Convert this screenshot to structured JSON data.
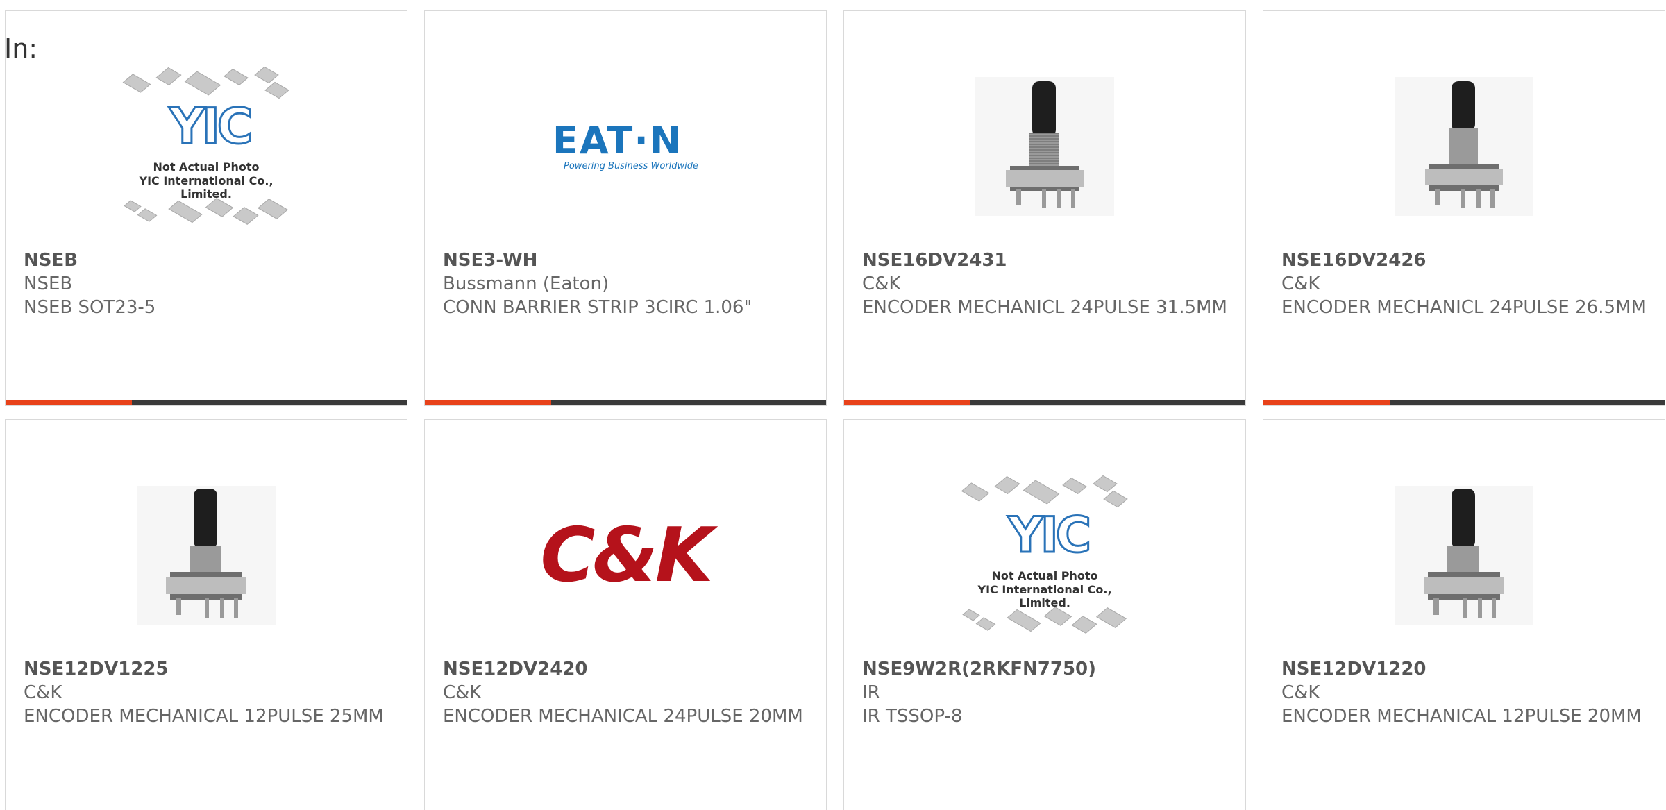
{
  "header": {
    "in_label": "In:"
  },
  "products": [
    {
      "pn": "NSEB",
      "mfr": "NSEB",
      "desc": "NSEB SOT23-5",
      "image": "yic-placeholder"
    },
    {
      "pn": "NSE3-WH",
      "mfr": "Bussmann (Eaton)",
      "desc": "CONN BARRIER STRIP 3CIRC 1.06\"",
      "image": "eaton-logo"
    },
    {
      "pn": "NSE16DV2431",
      "mfr": "C&K",
      "desc": "ENCODER MECHANICL 24PULSE 31.5MM",
      "image": "encoder-photo"
    },
    {
      "pn": "NSE16DV2426",
      "mfr": "C&K",
      "desc": "ENCODER MECHANICL 24PULSE 26.5MM",
      "image": "encoder-photo"
    },
    {
      "pn": "NSE12DV1225",
      "mfr": "C&K",
      "desc": "ENCODER MECHANICAL 12PULSE 25MM",
      "image": "encoder-photo"
    },
    {
      "pn": "NSE12DV2420",
      "mfr": "C&K",
      "desc": "ENCODER MECHANICAL 24PULSE 20MM",
      "image": "ck-logo"
    },
    {
      "pn": "NSE9W2R(2RKFN7750)",
      "mfr": "IR",
      "desc": "IR TSSOP-8",
      "image": "yic-placeholder"
    },
    {
      "pn": "NSE12DV1220",
      "mfr": "C&K",
      "desc": "ENCODER MECHANICAL 12PULSE 20MM",
      "image": "encoder-photo"
    }
  ],
  "placeholder": {
    "logo_text": "YIC",
    "line1": "Not Actual Photo",
    "line2": "YIC International Co., Limited."
  },
  "eaton": {
    "mark": "EAT·N",
    "tag": "Powering Business Worldwide"
  },
  "ck": {
    "mark": "C&K"
  },
  "colors": {
    "accent": "#e8421a",
    "bar": "#3a3a3a",
    "eaton_blue": "#1b75bc",
    "ck_red": "#b5121b",
    "yic_blue": "#2a73b8"
  }
}
